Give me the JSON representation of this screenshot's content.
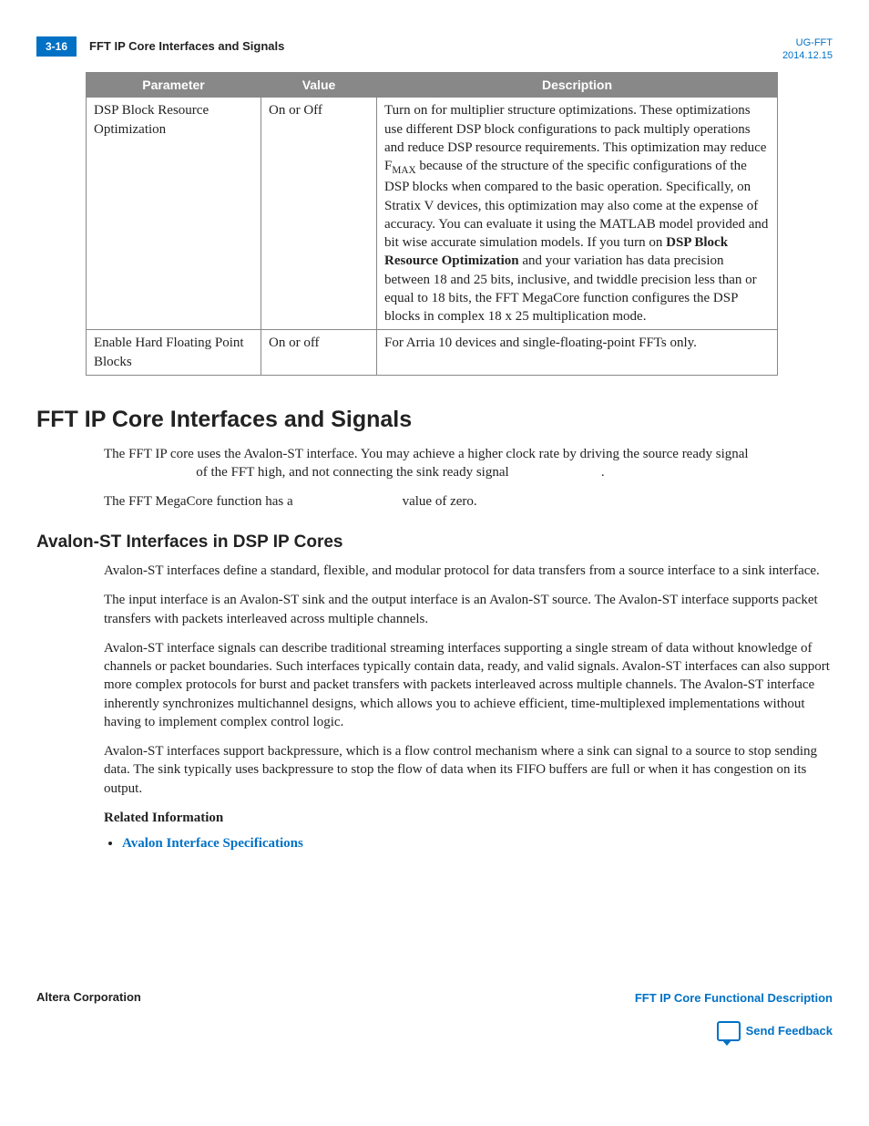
{
  "header": {
    "page_num": "3-16",
    "title": "FFT IP Core Interfaces and Signals",
    "doc_ref": "UG-FFT",
    "date": "2014.12.15"
  },
  "table": {
    "columns": [
      "Parameter",
      "Value",
      "Description"
    ],
    "rows": [
      {
        "param": "DSP Block Resource Optimization",
        "value": "On or Off",
        "desc_prefix": "Turn on for multiplier structure optimizations. These optimizations use different DSP block configurations to pack multiply operations and reduce DSP resource requirements. This optimization may reduce F",
        "desc_sub": "MAX",
        "desc_mid": " because of the structure of the specific configurations of the DSP blocks when compared to the basic operation. Specifically, on Stratix V devices, this optimization may also come at the expense of accuracy. You can evaluate it using the MATLAB model provided and bit wise accurate simulation models. If you turn on ",
        "desc_bold": "DSP Block Resource Optimization",
        "desc_suffix": " and your variation has data precision between 18 and 25 bits, inclusive, and twiddle precision less than or equal to 18 bits, the FFT MegaCore function configures the DSP blocks in complex 18 x 25 multiplication mode."
      },
      {
        "param": "Enable Hard Floating Point Blocks",
        "value": "On or off",
        "desc": "For Arria 10 devices and single-floating-point FFTs only."
      }
    ]
  },
  "section1": {
    "heading": "FFT IP Core Interfaces and Signals",
    "p1a": "The FFT IP core uses the Avalon-ST interface. You may achieve a higher clock rate by driving the source ready signal ",
    "p1b": " of the FFT high, and not connecting the sink ready signal ",
    "p1c": ".",
    "p2a": "The FFT MegaCore function has a ",
    "p2b": " value of zero."
  },
  "section2": {
    "heading": "Avalon-ST Interfaces in DSP IP Cores",
    "p1": "Avalon-ST interfaces define a standard, flexible, and modular protocol for data transfers from a source interface to a sink interface.",
    "p2": "The input interface is an Avalon-ST sink and the output interface is an Avalon-ST source. The Avalon-ST interface supports packet transfers with packets interleaved across multiple channels.",
    "p3": "Avalon-ST interface signals can describe traditional streaming interfaces supporting a single stream of data without knowledge of channels or packet boundaries. Such interfaces typically contain data, ready, and valid signals. Avalon-ST interfaces can also support more complex protocols for burst and packet transfers with packets interleaved across multiple channels. The Avalon-ST interface inherently synchronizes multichannel designs, which allows you to achieve efficient, time-multiplexed implementations without having to implement complex control logic.",
    "p4": "Avalon-ST interfaces support backpressure, which is a flow control mechanism where a sink can signal to a source to stop sending data. The sink typically uses backpressure to stop the flow of data when its FIFO buffers are full or when it has congestion on its output.",
    "related_heading": "Related Information",
    "related_link": "Avalon Interface Specifications"
  },
  "footer": {
    "left": "Altera Corporation",
    "right_link": "FFT IP Core Functional Description",
    "feedback": "Send Feedback"
  }
}
